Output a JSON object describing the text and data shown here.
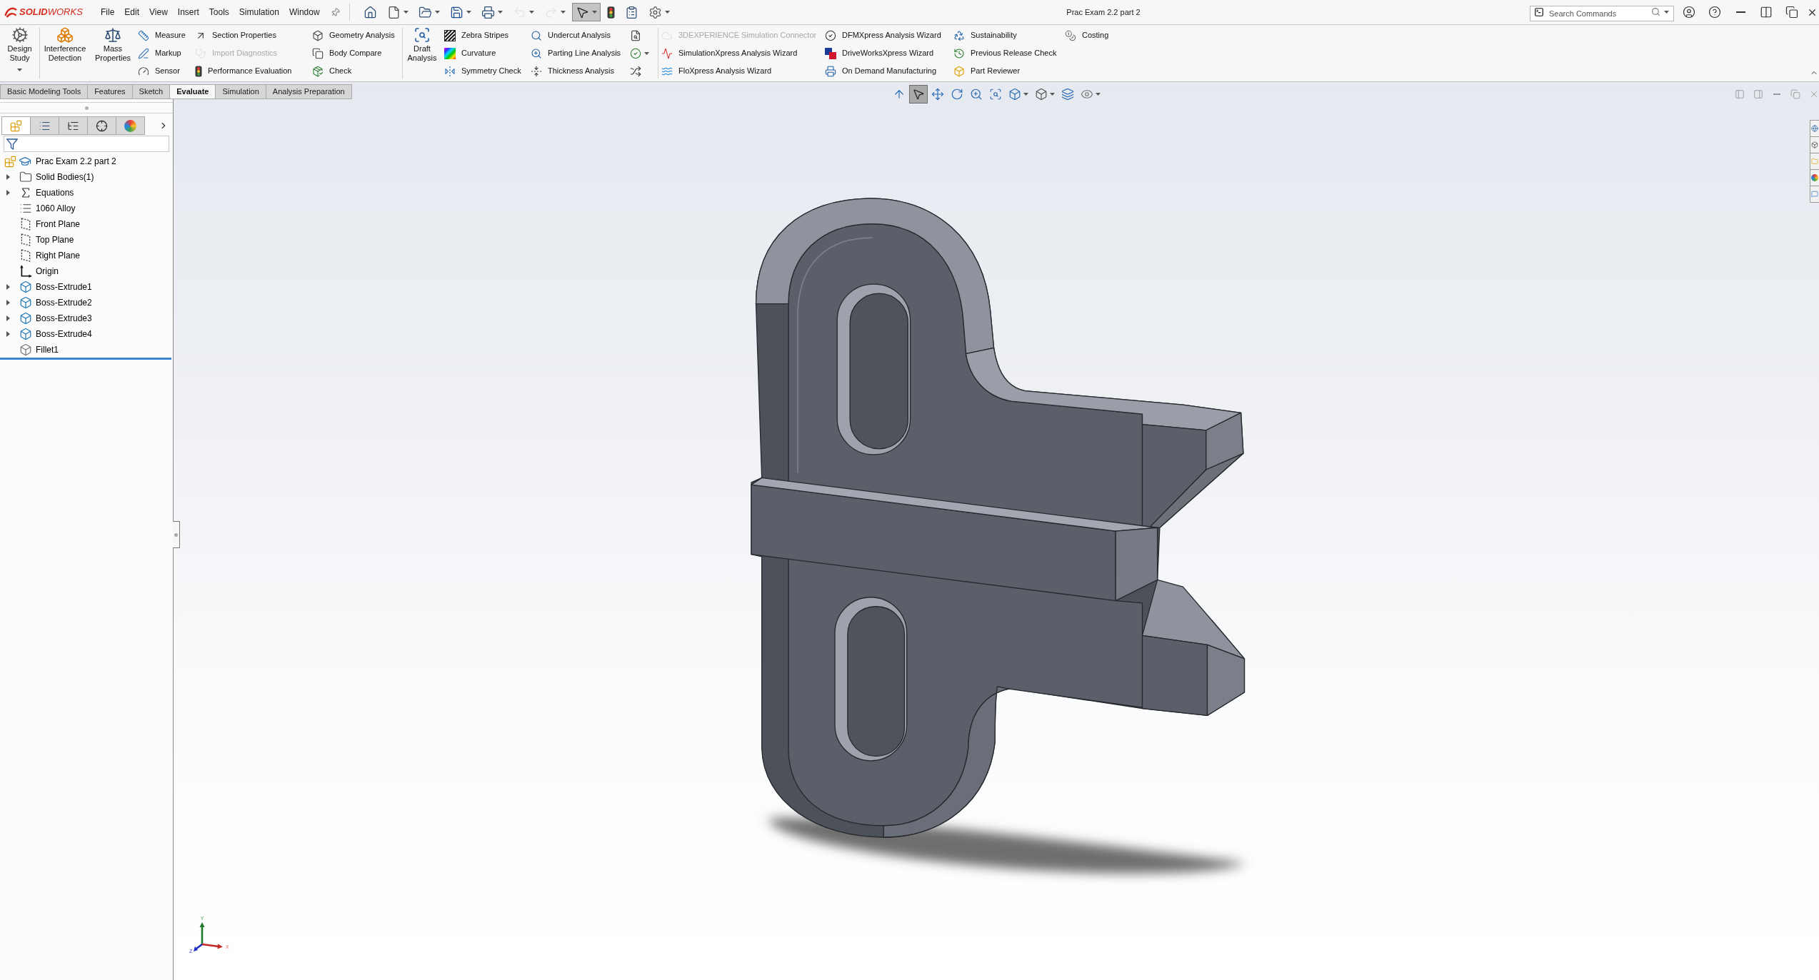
{
  "window": {
    "title": "Prac Exam 2.2 part 2"
  },
  "app_logo": {
    "text": "**SOLID**WORKS"
  },
  "menu": [
    "File",
    "Edit",
    "View",
    "Insert",
    "Tools",
    "Simulation",
    "Window"
  ],
  "quick_access": [
    {
      "dropdown": false,
      "disabled": false,
      "selected": false
    },
    {
      "dropdown": true,
      "disabled": false,
      "selected": false
    },
    {
      "dropdown": true,
      "disabled": false,
      "selected": false
    },
    {
      "dropdown": true,
      "disabled": false,
      "selected": false
    },
    {
      "dropdown": true,
      "disabled": false,
      "selected": false
    },
    {
      "dropdown": true,
      "disabled": true,
      "selected": false
    },
    {
      "dropdown": true,
      "disabled": true,
      "selected": false
    },
    {
      "dropdown": true,
      "disabled": false,
      "selected": true
    },
    {
      "dropdown": false,
      "disabled": false,
      "selected": false
    },
    {
      "dropdown": false,
      "disabled": false,
      "selected": false
    },
    {
      "dropdown": true,
      "disabled": false,
      "selected": false
    }
  ],
  "search": {
    "placeholder": "Search Commands"
  },
  "ribbon": [
    {
      "columns": [
        {
          "kind": "large",
          "label": "Design Study",
          "dropdown": true,
          "disabled": false
        }
      ]
    },
    {
      "columns": [
        {
          "kind": "large",
          "label": "Interference Detection",
          "dropdown": false,
          "disabled": false
        },
        {
          "kind": "large",
          "label": "Mass Properties",
          "dropdown": false,
          "disabled": false
        },
        {
          "kind": "stack",
          "items": [
            {
              "label": "Measure",
              "disabled": false
            },
            {
              "label": "Markup",
              "disabled": false
            },
            {
              "label": "Sensor",
              "disabled": false
            }
          ]
        },
        {
          "kind": "stack",
          "items": [
            {
              "label": "Section Properties",
              "disabled": false
            },
            {
              "label": "Import Diagnostics",
              "disabled": true
            },
            {
              "label": "Performance Evaluation",
              "disabled": false
            }
          ]
        },
        {
          "kind": "stack",
          "items": [
            {
              "label": "Geometry Analysis",
              "disabled": false
            },
            {
              "label": "Body Compare",
              "disabled": false
            },
            {
              "label": "Check",
              "disabled": false
            }
          ]
        }
      ]
    },
    {
      "columns": [
        {
          "kind": "large",
          "label": "Draft Analysis",
          "dropdown": false,
          "disabled": false
        },
        {
          "kind": "stack",
          "items": [
            {
              "label": "Zebra Stripes",
              "disabled": false
            },
            {
              "label": "Curvature",
              "disabled": false
            },
            {
              "label": "Symmetry Check",
              "disabled": false
            }
          ]
        },
        {
          "kind": "stack",
          "items": [
            {
              "label": "Undercut Analysis",
              "disabled": false
            },
            {
              "label": "Parting Line Analysis",
              "disabled": false
            },
            {
              "label": "Thickness Analysis",
              "disabled": false
            }
          ]
        },
        {
          "kind": "icons",
          "items": [
            {
              "dropdown": false,
              "disabled": false
            },
            {
              "dropdown": true,
              "disabled": false
            },
            {
              "dropdown": false,
              "disabled": false
            }
          ]
        }
      ]
    },
    {
      "columns": [
        {
          "kind": "stack",
          "items": [
            {
              "label": "3DEXPERIENCE Simulation Connector",
              "disabled": true
            },
            {
              "label": "SimulationXpress Analysis Wizard",
              "disabled": false
            },
            {
              "label": "FloXpress Analysis Wizard",
              "disabled": false
            }
          ]
        },
        {
          "kind": "stack",
          "items": [
            {
              "label": "DFMXpress Analysis Wizard",
              "disabled": false
            },
            {
              "label": "DriveWorksXpress Wizard",
              "disabled": false
            },
            {
              "label": "On Demand Manufacturing",
              "disabled": false
            }
          ]
        },
        {
          "kind": "stack",
          "items": [
            {
              "label": "Sustainability",
              "disabled": false
            },
            {
              "label": "Previous Release Check",
              "disabled": false
            },
            {
              "label": "Part Reviewer",
              "disabled": false
            }
          ]
        },
        {
          "kind": "stack",
          "items": [
            {
              "label": "Costing",
              "disabled": false
            }
          ]
        }
      ]
    }
  ],
  "command_tabs": [
    {
      "label": "Basic Modeling Tools",
      "selected": false
    },
    {
      "label": "Features",
      "selected": false
    },
    {
      "label": "Sketch",
      "selected": false
    },
    {
      "label": "Evaluate",
      "selected": true
    },
    {
      "label": "Simulation",
      "selected": false
    },
    {
      "label": "Analysis Preparation",
      "selected": false
    }
  ],
  "panel_tabs": [
    {
      "selected": true
    },
    {
      "selected": false
    },
    {
      "selected": false
    },
    {
      "selected": false
    },
    {
      "selected": false
    }
  ],
  "feature_tree": {
    "label": "Prac Exam 2.2 part 2",
    "children": [
      {
        "label": "Solid Bodies(1)",
        "collapsed": true
      },
      {
        "label": "Equations",
        "collapsed": true
      },
      {
        "label": "1060 Alloy",
        "collapsed": false
      },
      {
        "label": "Front Plane",
        "collapsed": false
      },
      {
        "label": "Top Plane",
        "collapsed": false
      },
      {
        "label": "Right Plane",
        "collapsed": false
      },
      {
        "label": "Origin",
        "collapsed": false
      },
      {
        "label": "Boss-Extrude1",
        "collapsed": true
      },
      {
        "label": "Boss-Extrude2",
        "collapsed": true
      },
      {
        "label": "Boss-Extrude3",
        "collapsed": true
      },
      {
        "label": "Boss-Extrude4",
        "collapsed": true
      },
      {
        "label": "Fillet1",
        "collapsed": false
      }
    ]
  },
  "view_toolbar": [
    {
      "dropdown": false,
      "selected": false
    },
    {
      "dropdown": false,
      "selected": true
    },
    {
      "dropdown": false,
      "selected": false
    },
    {
      "dropdown": false,
      "selected": false
    },
    {
      "dropdown": false,
      "selected": false
    },
    {
      "dropdown": false,
      "selected": false
    },
    {
      "dropdown": true,
      "selected": false
    },
    {
      "dropdown": true,
      "selected": false
    },
    {
      "dropdown": false,
      "selected": false
    },
    {
      "dropdown": true,
      "selected": false
    }
  ],
  "axis_triad": {
    "y_label": "Y",
    "x_label": "X",
    "z_label": "Z"
  }
}
